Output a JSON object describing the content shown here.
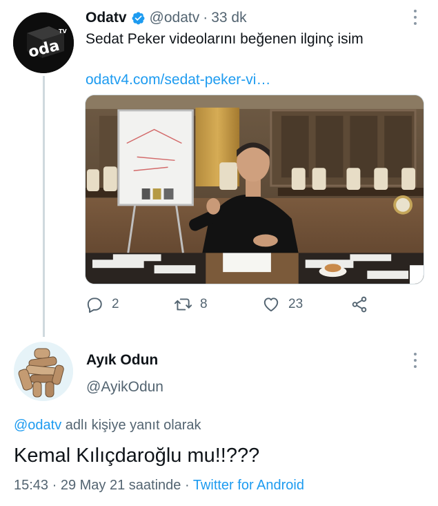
{
  "tweet": {
    "author_name": "Odatv",
    "author_handle": "@odatv",
    "separator": "·",
    "time_ago": "33 dk",
    "text": "Sedat Peker videolarını beğenen ilginç isim",
    "link": "odatv4.com/sedat-peker-vi…",
    "avatar_icon": "oda-tv-logo",
    "actions": {
      "reply_count": "2",
      "retweet_count": "8",
      "like_count": "23"
    }
  },
  "reply": {
    "author_name": "Ayık Odun",
    "author_handle": "@AyikOdun",
    "replying_to_handle": "@odatv",
    "replying_to_suffix": " adlı kişiye yanıt olarak",
    "text": "Kemal Kılıçdaroğlu mu!!???",
    "time": "15:43",
    "date_suffix": " · 29 May 21 saatinde · ",
    "client": "Twitter for Android"
  },
  "colors": {
    "link": "#1d9bf0",
    "secondary_text": "#536471",
    "primary_text": "#0f1419",
    "thread_line": "#cfd9de"
  }
}
